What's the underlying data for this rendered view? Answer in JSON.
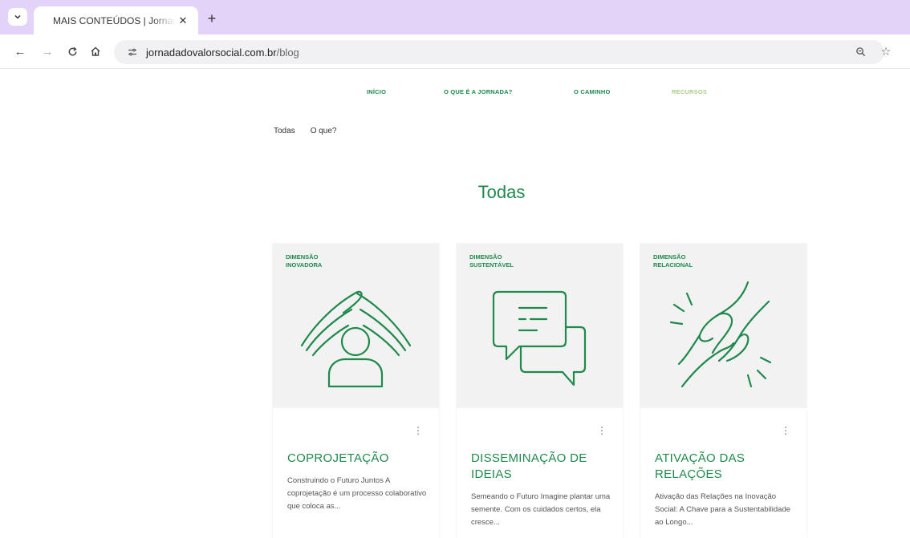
{
  "browser": {
    "tab_title": "MAIS CONTEÚDOS | Jornada do Valor Social",
    "url_host": "jornadadovalorsocial.com.br",
    "url_path": "/blog"
  },
  "site_nav": {
    "items": [
      {
        "label": "INÍCIO"
      },
      {
        "label": "O QUE É A JORNADA?"
      },
      {
        "label": "O CAMINHO"
      },
      {
        "label": "RECURSOS"
      }
    ]
  },
  "filters": {
    "items": [
      {
        "label": "Todas"
      },
      {
        "label": "O que?"
      }
    ]
  },
  "section": {
    "title": "Todas"
  },
  "cards": [
    {
      "dimension": "DIMENSÃO\nINOVADORA",
      "illustration": "hands-over-person-icon",
      "title": "COPROJETAÇÃO",
      "excerpt": "Construindo o Futuro Juntos A coprojetação é um processo colaborativo que coloca as..."
    },
    {
      "dimension": "DIMENSÃO\nSUSTENTÁVEL",
      "illustration": "speech-bubbles-icon",
      "title": "DISSEMINAÇÃO DE IDEIAS",
      "excerpt": "Semeando o Futuro Imagine plantar uma semente. Com os cuidados certos, ela cresce..."
    },
    {
      "dimension": "DIMENSÃO\nRELACIONAL",
      "illustration": "handshake-icon",
      "title": "ATIVAÇÃO DAS RELAÇÕES",
      "excerpt": "Ativação das Relações na Inovação Social: A Chave para a Sustentabilidade ao Longo..."
    }
  ],
  "colors": {
    "brand_green": "#1f8a4c",
    "active_nav": "#a9d08a",
    "tabbar_bg": "#e3d3f9"
  }
}
